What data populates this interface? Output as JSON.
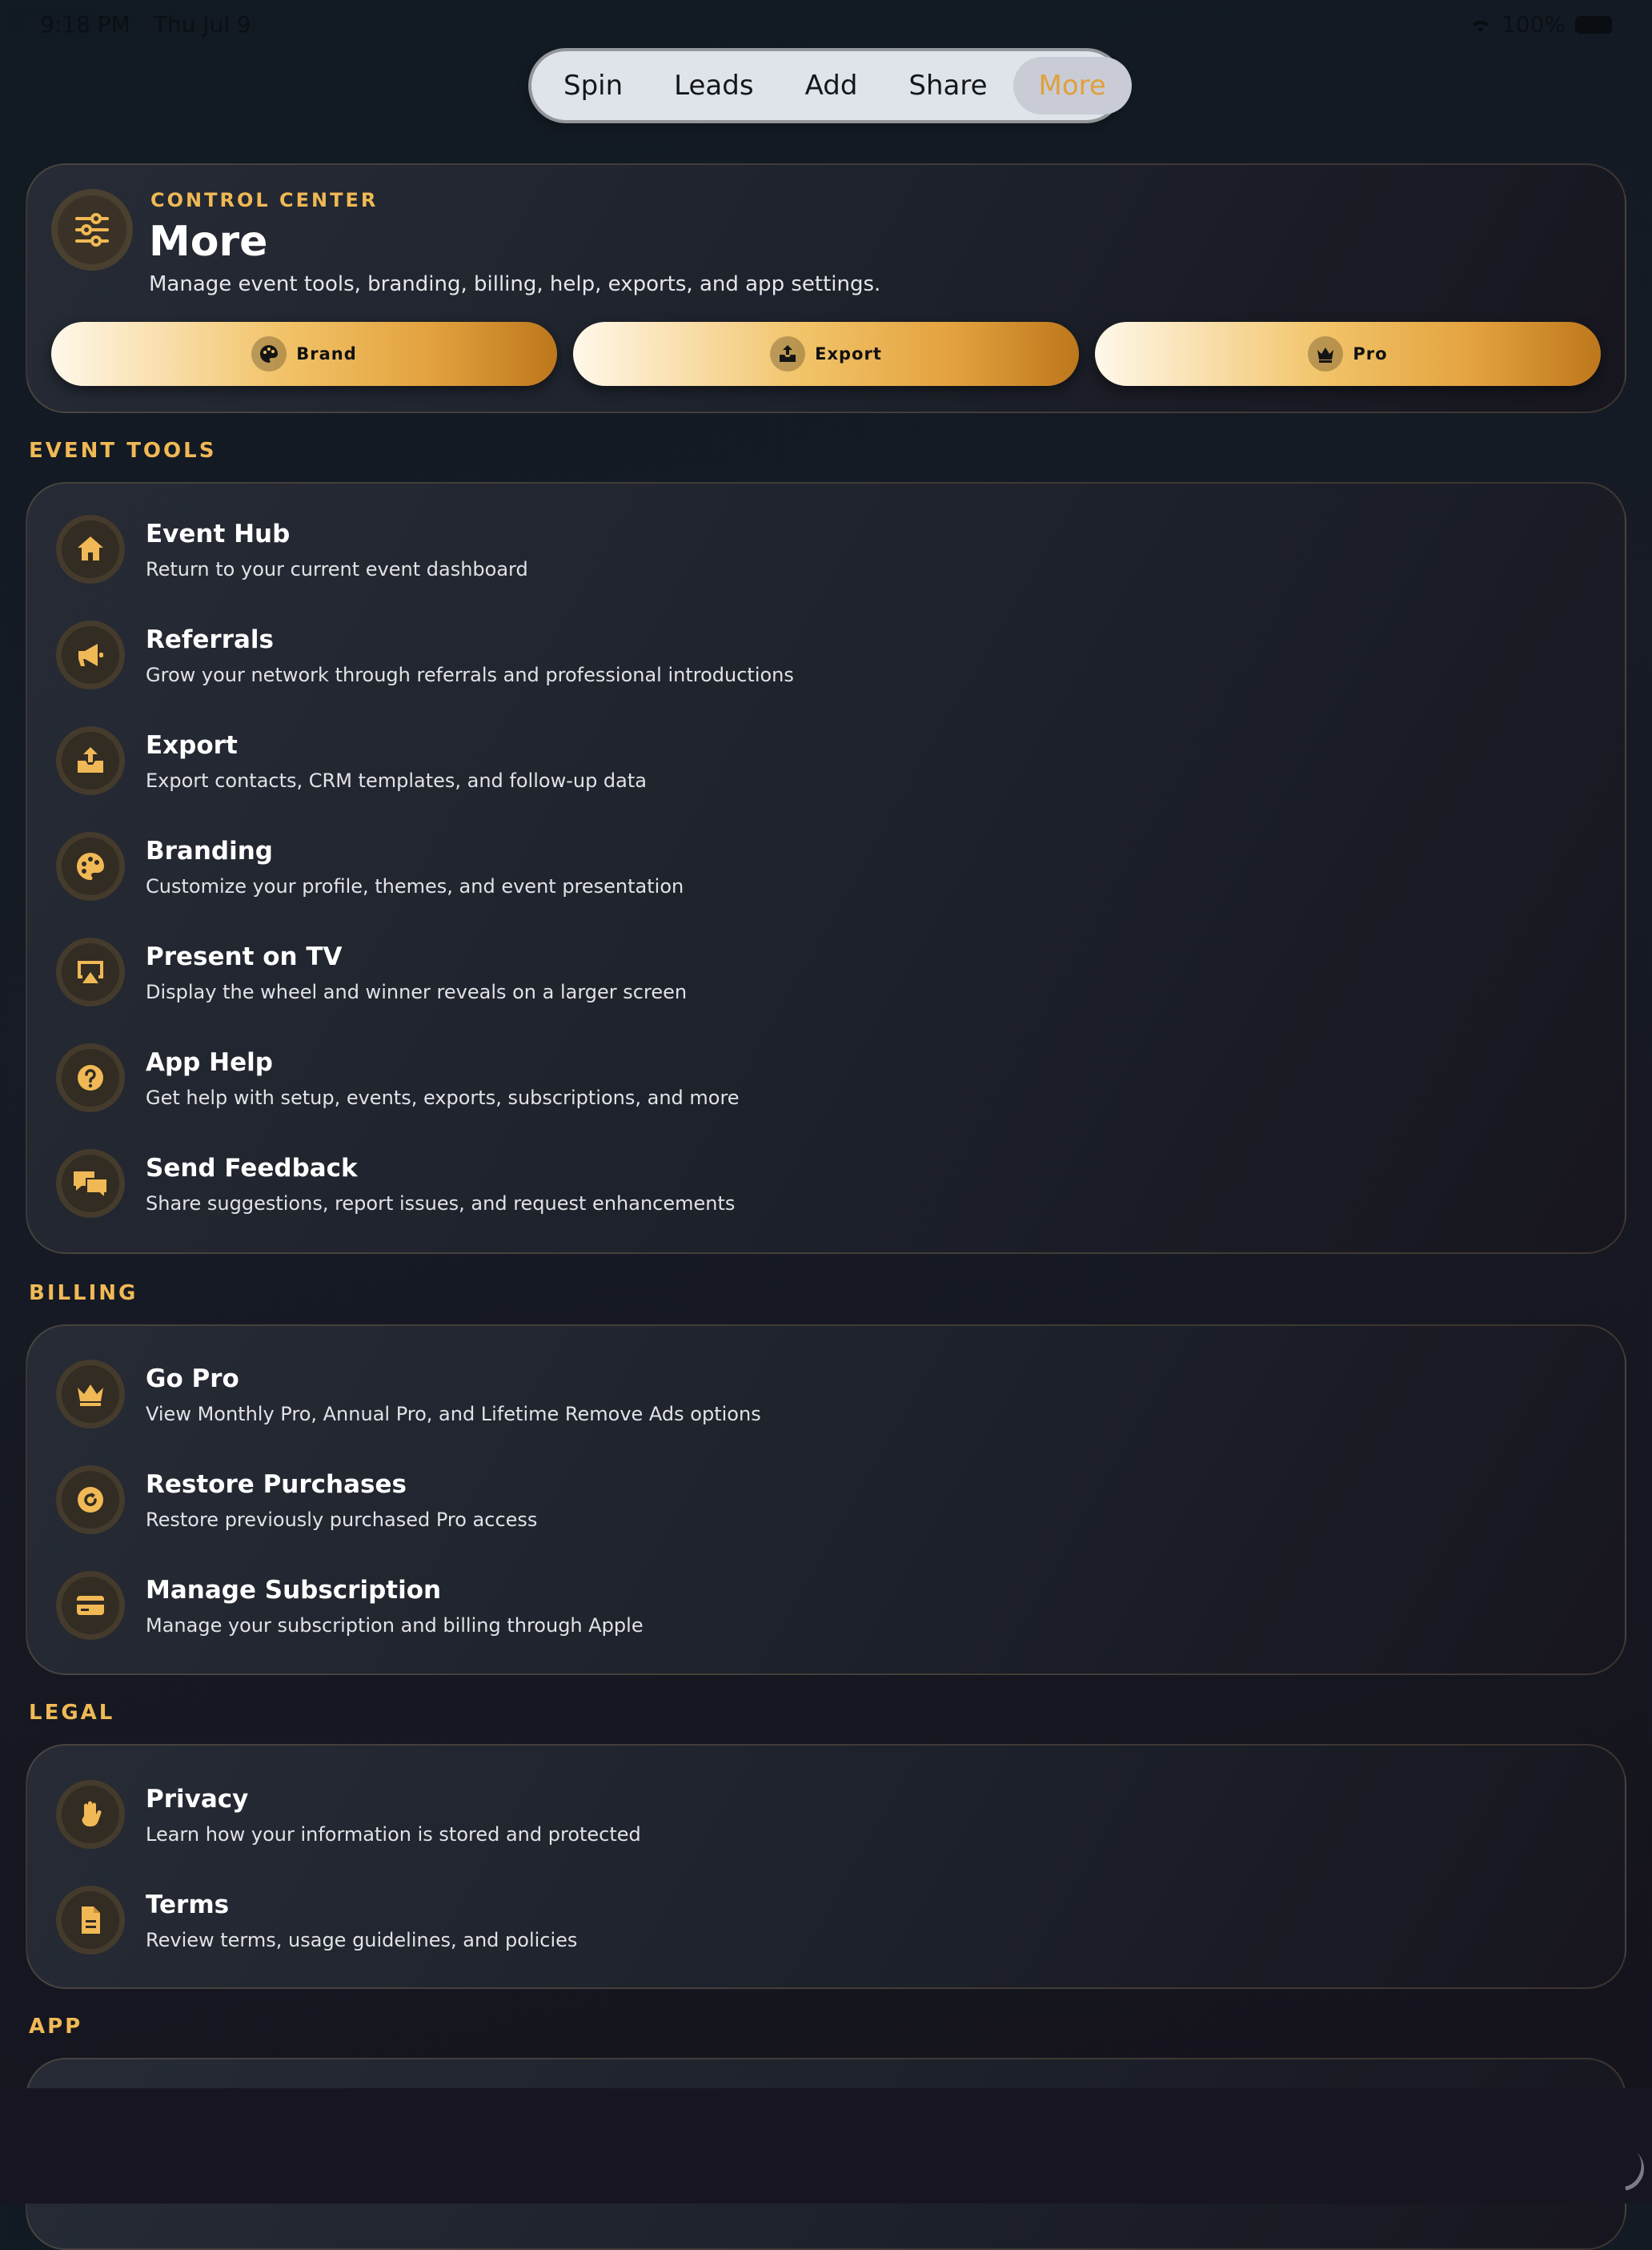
{
  "status_bar": {
    "time": "9:18 PM",
    "date": "Thu Jul 9",
    "battery": "100%"
  },
  "tabs": [
    {
      "label": "Spin"
    },
    {
      "label": "Leads"
    },
    {
      "label": "Add"
    },
    {
      "label": "Share"
    },
    {
      "label": "More",
      "active": true
    }
  ],
  "header": {
    "kicker": "CONTROL CENTER",
    "title": "More",
    "subtitle": "Manage event tools, branding, billing, help, exports, and app settings.",
    "icon": "sliders-icon",
    "quick_actions": [
      {
        "label": "Brand",
        "icon": "palette-icon"
      },
      {
        "label": "Export",
        "icon": "tray-upload-icon"
      },
      {
        "label": "Pro",
        "icon": "crown-icon"
      }
    ]
  },
  "sections": {
    "event_tools": {
      "label": "EVENT TOOLS",
      "items": [
        {
          "title": "Event Hub",
          "subtitle": "Return to your current event dashboard",
          "icon": "house-icon"
        },
        {
          "title": "Referrals",
          "subtitle": "Grow your network through referrals and professional introductions",
          "icon": "megaphone-icon"
        },
        {
          "title": "Export",
          "subtitle": "Export contacts, CRM templates, and follow-up data",
          "icon": "tray-upload-icon"
        },
        {
          "title": "Branding",
          "subtitle": "Customize your profile, themes, and event presentation",
          "icon": "palette-icon"
        },
        {
          "title": "Present on TV",
          "subtitle": "Display the wheel and winner reveals on a larger screen",
          "icon": "airplay-icon"
        },
        {
          "title": "App Help",
          "subtitle": "Get help with setup, events, exports, subscriptions, and more",
          "icon": "question-icon"
        },
        {
          "title": "Send Feedback",
          "subtitle": "Share suggestions, report issues, and request enhancements",
          "icon": "chat-bubbles-icon"
        }
      ]
    },
    "billing": {
      "label": "BILLING",
      "items": [
        {
          "title": "Go Pro",
          "subtitle": "View Monthly Pro, Annual Pro, and Lifetime Remove Ads options",
          "icon": "crown-icon"
        },
        {
          "title": "Restore Purchases",
          "subtitle": "Restore previously purchased Pro access",
          "icon": "restore-icon"
        },
        {
          "title": "Manage Subscription",
          "subtitle": "Manage your subscription and billing through Apple",
          "icon": "credit-card-icon"
        }
      ]
    },
    "legal": {
      "label": "LEGAL",
      "items": [
        {
          "title": "Privacy",
          "subtitle": "Learn how your information is stored and protected",
          "icon": "hand-icon"
        },
        {
          "title": "Terms",
          "subtitle": "Review terms, usage guidelines, and policies",
          "icon": "document-icon"
        }
      ]
    },
    "app": {
      "label": "APP"
    }
  },
  "colors": {
    "accent": "#f0b955",
    "background": "#141a22",
    "card": "#232832"
  }
}
